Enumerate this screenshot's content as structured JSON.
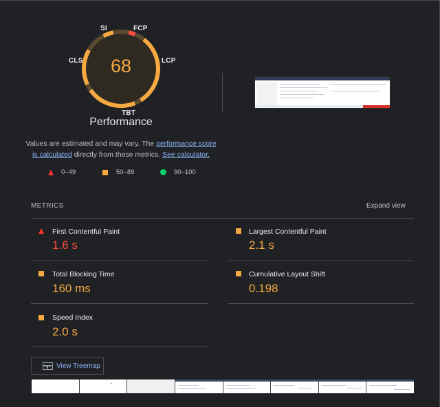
{
  "gauge": {
    "score": "68",
    "title": "Performance",
    "labels": {
      "si": "SI",
      "fcp": "FCP",
      "lcp": "LCP",
      "tbt": "TBT",
      "cls": "CLS"
    }
  },
  "description": {
    "prefix": "Values are estimated and may vary. The ",
    "link1": "performance score is calculated",
    "middle": " directly from these metrics. ",
    "link2": "See calculator."
  },
  "legend": [
    {
      "range": "0–49",
      "color": "#ff4e42",
      "icon": "triangle-icon"
    },
    {
      "range": "50–89",
      "color": "#f6a940",
      "icon": "square-icon"
    },
    {
      "range": "90–100",
      "color": "#0cce6b",
      "icon": "circle-icon"
    }
  ],
  "metrics": {
    "title": "METRICS",
    "expand": "Expand view",
    "fcp": {
      "name": "First Contentful Paint",
      "value": "1.6 s",
      "status": "fail"
    },
    "lcp": {
      "name": "Largest Contentful Paint",
      "value": "2.1 s",
      "status": "average"
    },
    "tbt": {
      "name": "Total Blocking Time",
      "value": "160 ms",
      "status": "average"
    },
    "cls": {
      "name": "Cumulative Layout Shift",
      "value": "0.198",
      "status": "average"
    },
    "si": {
      "name": "Speed Index",
      "value": "2.0 s",
      "status": "average"
    }
  },
  "treemap": {
    "label": "View Treemap"
  },
  "filmstrip_marker": "^"
}
